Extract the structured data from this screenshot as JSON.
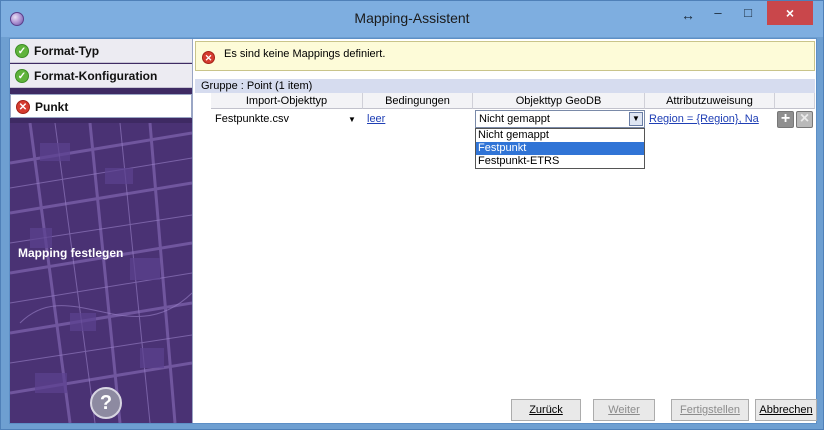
{
  "window": {
    "title": "Mapping-Assistent",
    "close_glyph": "×",
    "minimize_glyph": "–",
    "maximize_glyph": "□",
    "resize_glyph": "↔"
  },
  "sidebar": {
    "steps": [
      {
        "label": "Format-Typ",
        "status": "ok",
        "icon": "check-icon"
      },
      {
        "label": "Format-Konfiguration",
        "status": "ok",
        "icon": "check-icon"
      },
      {
        "label": "Punkt",
        "status": "error",
        "icon": "error-icon"
      }
    ],
    "section_label": "Mapping festlegen",
    "help_glyph": "?"
  },
  "message": {
    "text": "Es sind keine Mappings definiert.",
    "icon": "error-icon"
  },
  "group": {
    "label": "Gruppe : Point (1 item)"
  },
  "grid": {
    "columns": [
      "Import-Objekttyp",
      "Bedingungen",
      "Objekttyp GeoDB",
      "Attributzuweisung"
    ],
    "row": {
      "import_type": "Festpunkte.csv",
      "conditions": "leer",
      "geodb_type": "Nicht gemappt",
      "attribute_assignment": "Region = {Region}, Na"
    },
    "dropdown_options": [
      {
        "label": "Nicht gemappt",
        "selected": false
      },
      {
        "label": "Festpunkt",
        "selected": true
      },
      {
        "label": "Festpunkt-ETRS",
        "selected": false
      }
    ],
    "add_glyph": "+",
    "delete_glyph": "×"
  },
  "footer": {
    "back": "Zurück",
    "next": "Weiter",
    "finish": "Fertigstellen",
    "cancel": "Abbrechen"
  },
  "colors": {
    "titlebar": "#7eaee0",
    "close": "#c9474b",
    "sidebar": "#3e2a63",
    "selection": "#3074d6",
    "ok": "#5fb33c",
    "error": "#d53b2f"
  }
}
